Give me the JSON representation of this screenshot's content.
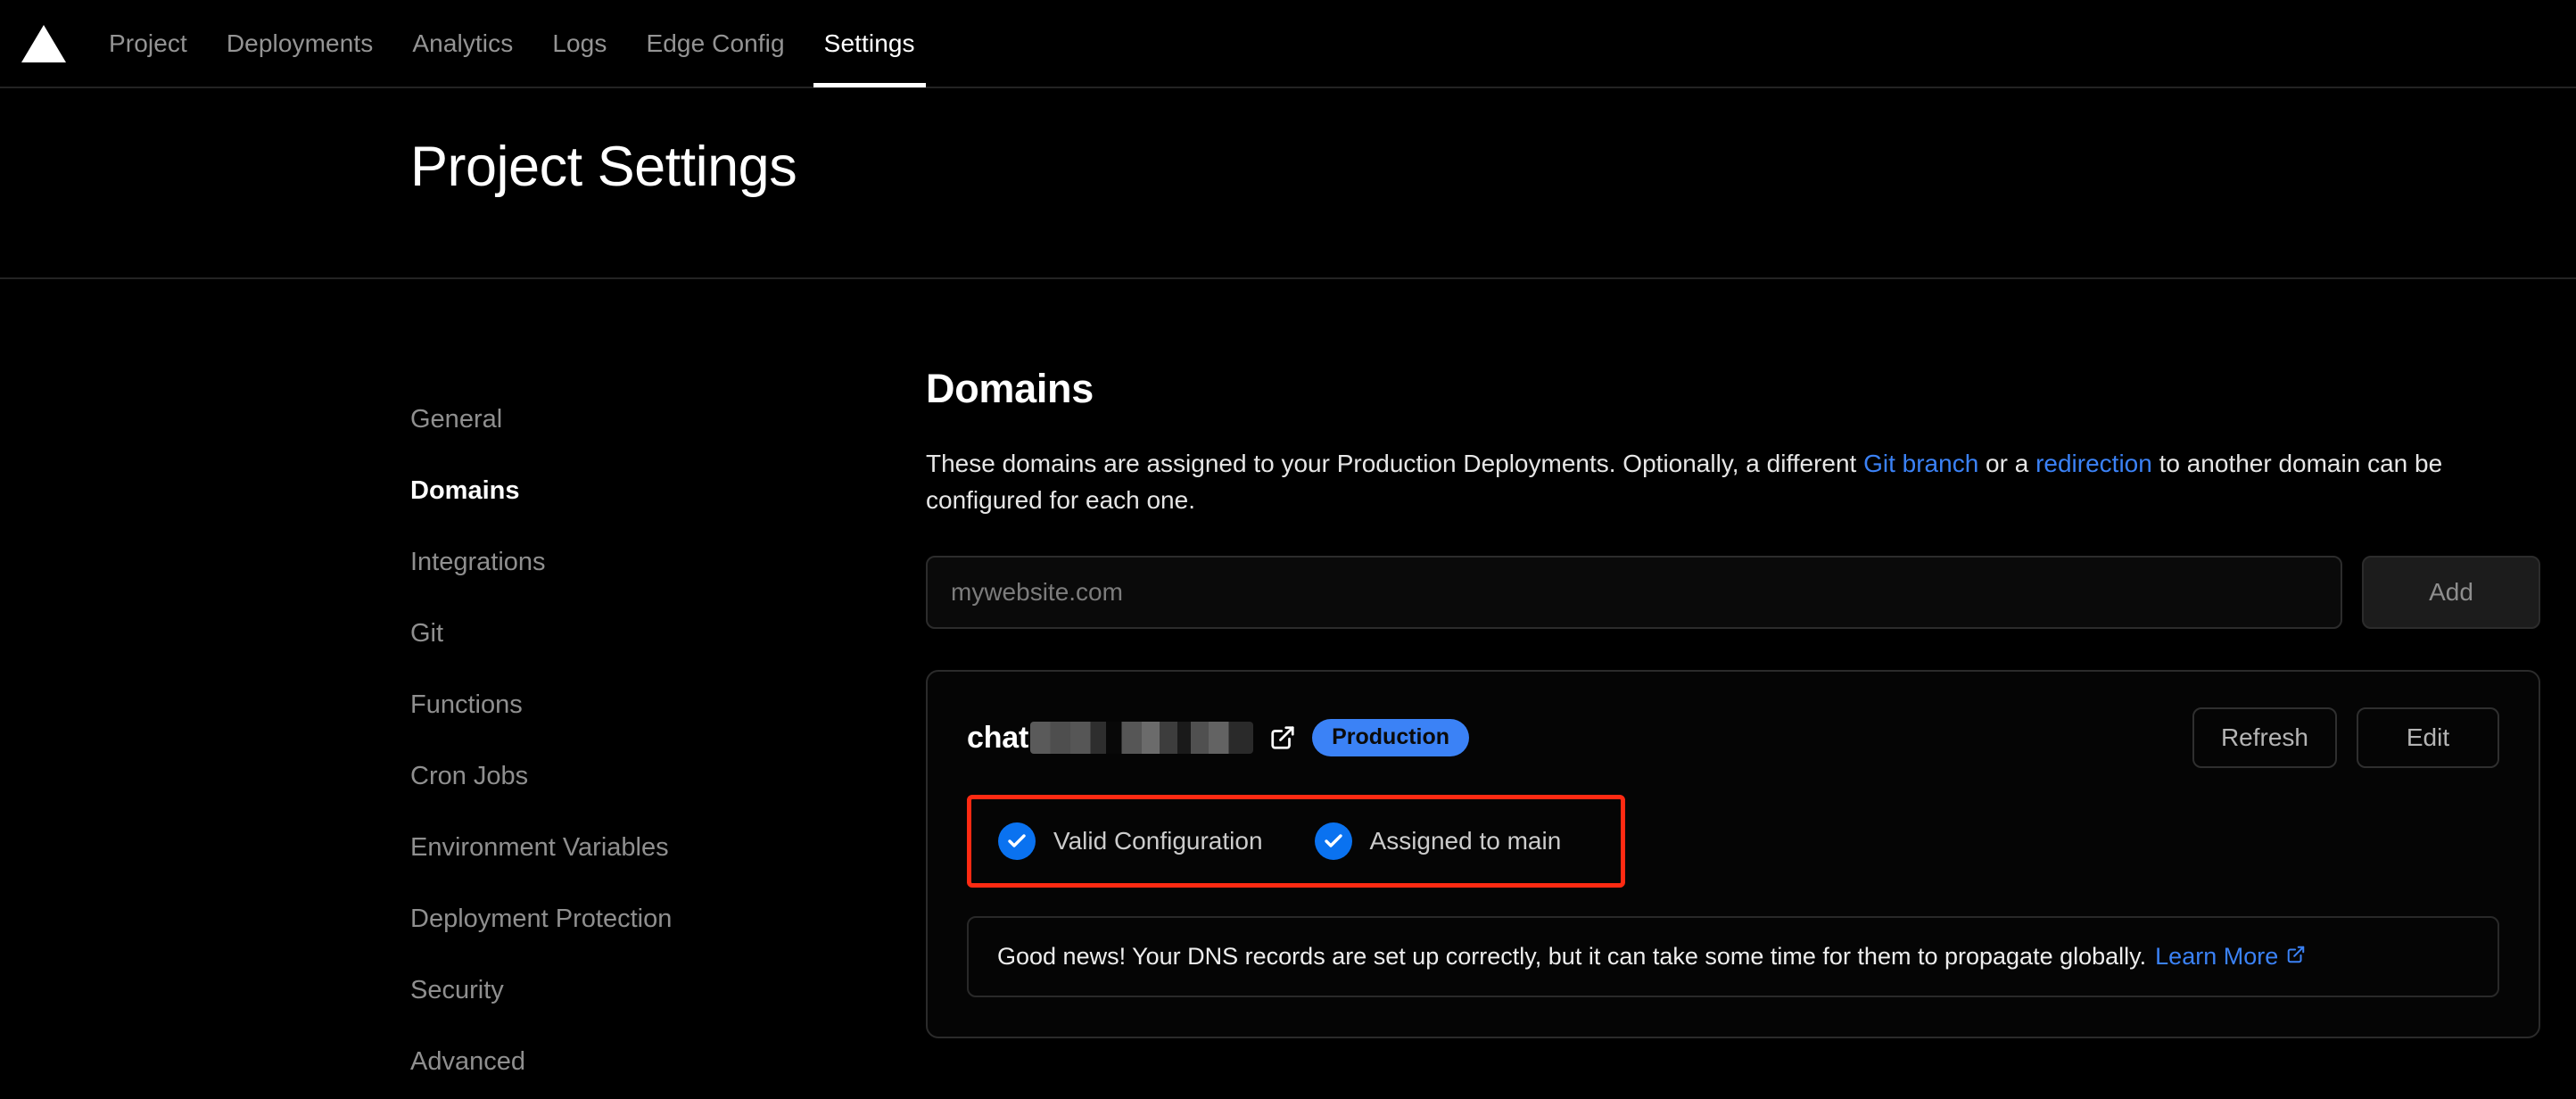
{
  "nav": {
    "logo_icon": "triangle-logo-icon",
    "items": [
      {
        "label": "Project",
        "active": false
      },
      {
        "label": "Deployments",
        "active": false
      },
      {
        "label": "Analytics",
        "active": false
      },
      {
        "label": "Logs",
        "active": false
      },
      {
        "label": "Edge Config",
        "active": false
      },
      {
        "label": "Settings",
        "active": true
      }
    ]
  },
  "header": {
    "title": "Project Settings"
  },
  "sidebar": {
    "items": [
      {
        "label": "General"
      },
      {
        "label": "Domains"
      },
      {
        "label": "Integrations"
      },
      {
        "label": "Git"
      },
      {
        "label": "Functions"
      },
      {
        "label": "Cron Jobs"
      },
      {
        "label": "Environment Variables"
      },
      {
        "label": "Deployment Protection"
      },
      {
        "label": "Security"
      },
      {
        "label": "Advanced"
      }
    ],
    "active_label": "Domains"
  },
  "main": {
    "section_title": "Domains",
    "description": {
      "part1": "These domains are assigned to your Production Deployments. Optionally, a different ",
      "link1": "Git branch",
      "part2": " or a ",
      "link2": "redirection",
      "part3": " to another domain can be configured for each one."
    },
    "add_form": {
      "input_value": "",
      "input_placeholder": "mywebsite.com",
      "add_label": "Add"
    },
    "domain_card": {
      "domain_prefix": "chat",
      "domain_redacted": true,
      "external_link_icon": "external-link-icon",
      "badge_label": "Production",
      "refresh_label": "Refresh",
      "edit_label": "Edit",
      "statuses": [
        {
          "label": "Valid Configuration",
          "icon": "check-circle-icon",
          "ok": true
        },
        {
          "label": "Assigned to main",
          "icon": "check-circle-icon",
          "ok": true
        }
      ],
      "notice": {
        "text": "Good news! Your DNS records are set up correctly, but it can take some time for them to propagate globally.",
        "link_label": "Learn More",
        "link_icon": "external-link-icon"
      }
    }
  },
  "colors": {
    "background": "#000000",
    "accent_blue": "#3b82f6",
    "check_blue": "#0a72f0",
    "annotation_red": "#ff2a12",
    "border": "#2b2b2b",
    "muted_text": "#8f8f8f"
  }
}
